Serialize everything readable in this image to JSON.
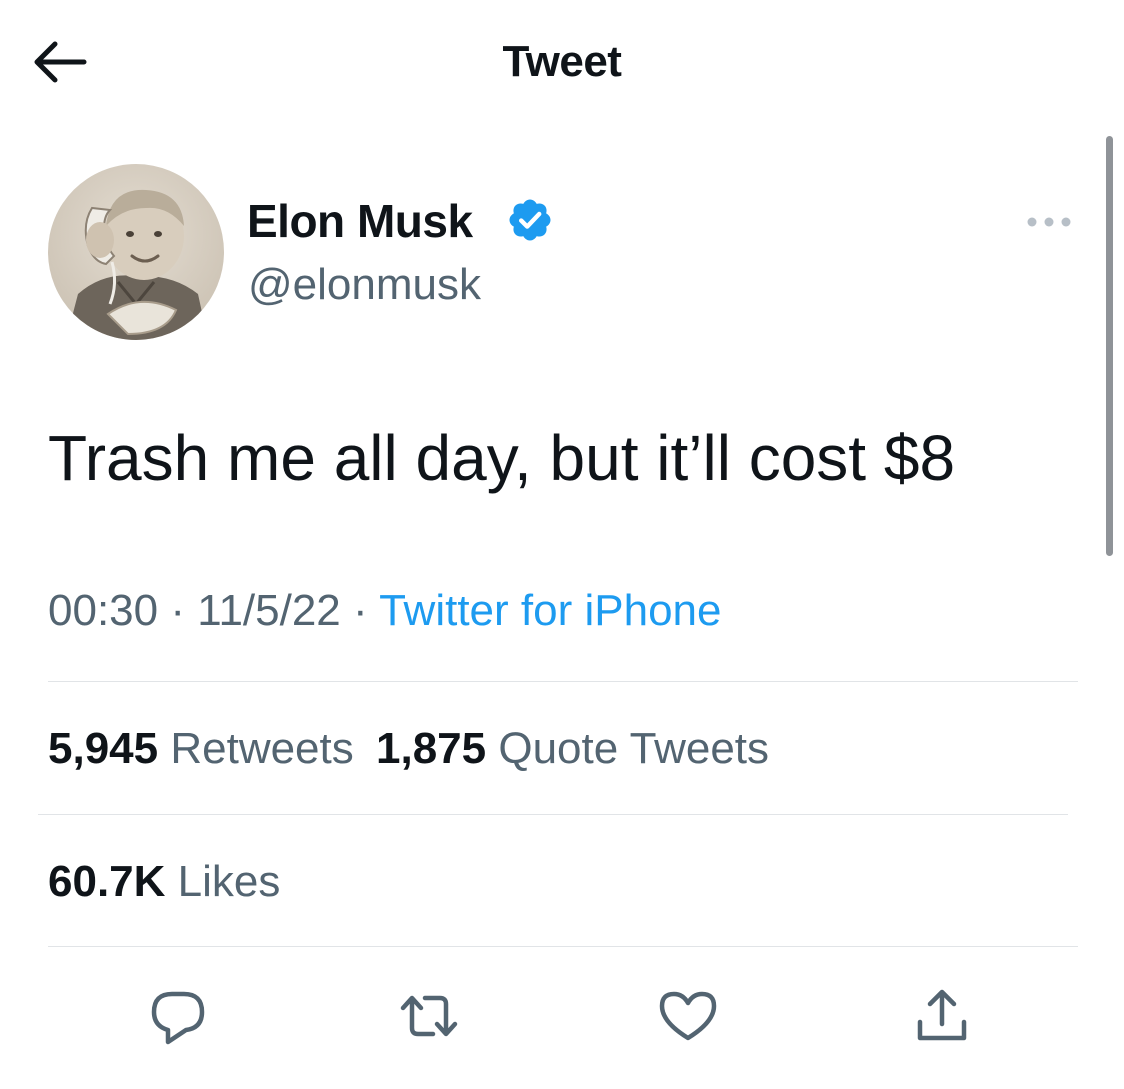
{
  "header": {
    "title": "Tweet",
    "back_icon": "arrow-left-icon"
  },
  "tweet": {
    "author": {
      "name": "Elon Musk",
      "handle": "@elonmusk",
      "verified": true,
      "verified_icon": "verified-badge-icon",
      "avatar_description": "avatar"
    },
    "more_icon": "more-horizontal-icon",
    "text": "Trash me all day, but it’ll cost $8",
    "time": "00:30",
    "date": "11/5/22",
    "separator": "·",
    "source": "Twitter for iPhone"
  },
  "stats": {
    "retweets": {
      "count": "5,945",
      "label": "Retweets"
    },
    "quote_tweets": {
      "count": "1,875",
      "label": "Quote Tweets"
    },
    "likes": {
      "count": "60.7K",
      "label": "Likes"
    }
  },
  "actions": [
    {
      "icon": "reply-icon"
    },
    {
      "icon": "retweet-icon"
    },
    {
      "icon": "like-icon"
    },
    {
      "icon": "share-icon"
    }
  ],
  "colors": {
    "text_primary": "#0f1419",
    "text_secondary": "#536471",
    "accent": "#1d9bf0",
    "divider": "#e1e4e7",
    "scrollbar": "#8f9398"
  }
}
